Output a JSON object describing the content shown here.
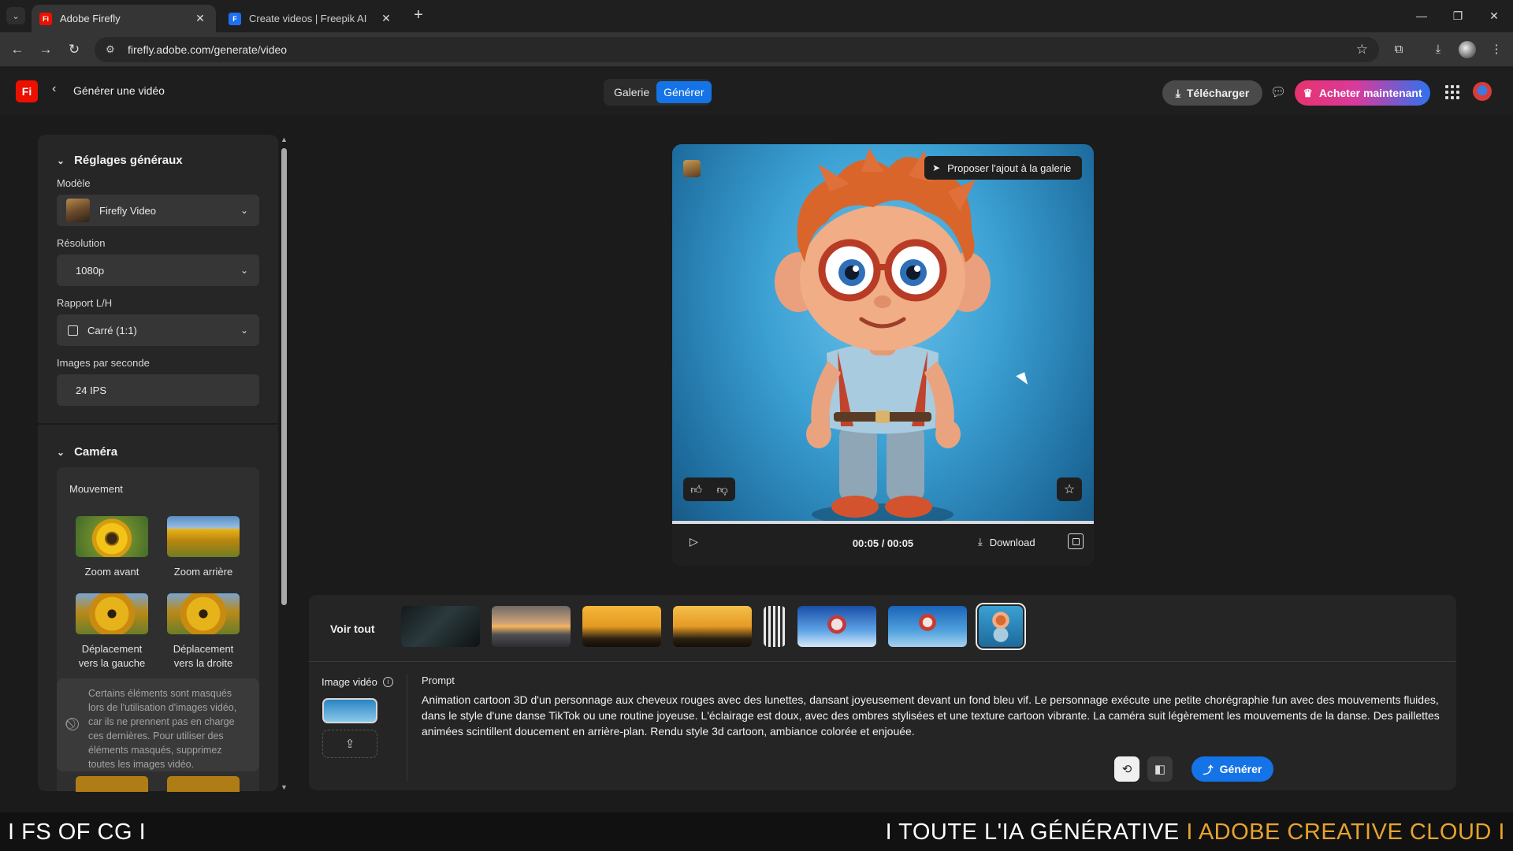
{
  "browser": {
    "tabs": [
      {
        "title": "Adobe Firefly",
        "favicon": "firefly-icon",
        "active": true
      },
      {
        "title": "Create videos | Freepik AI",
        "favicon": "freepik-icon",
        "active": false
      }
    ],
    "new_tab": "+",
    "url": "firefly.adobe.com/generate/video"
  },
  "app": {
    "logo": "Fi",
    "page_title": "Générer une vidéo",
    "segments": {
      "gallery": "Galerie",
      "generate": "Générer"
    },
    "download_label": "Télécharger",
    "buy_label": "Acheter maintenant",
    "accent": "#1473e6"
  },
  "settings": {
    "general_title": "Réglages généraux",
    "model_label": "Modèle",
    "model_value": "Firefly Video",
    "resolution_label": "Résolution",
    "resolution_value": "1080p",
    "ratio_label": "Rapport L/H",
    "ratio_value": "Carré (1:1)",
    "fps_label": "Images par seconde",
    "fps_value": "24 IPS",
    "camera_title": "Caméra",
    "motion_title": "Mouvement",
    "motions": [
      {
        "label": "Zoom avant"
      },
      {
        "label": "Zoom arrière"
      },
      {
        "label": "Déplacement vers la gauche"
      },
      {
        "label": "Déplacement vers la droite"
      }
    ],
    "notice": "Certains éléments sont masqués lors de l'utilisation d'images vidéo, car ils ne prennent pas en charge ces dernières. Pour utiliser des éléments masqués, supprimez toutes les images vidéo."
  },
  "player": {
    "propose_label": "Proposer l'ajout à la galerie",
    "time": "00:05 / 00:05",
    "progress": 1.0,
    "download_label": "Download"
  },
  "history": {
    "see_all": "Voir tout",
    "thumbs": [
      {
        "name": "thumb-dark-water"
      },
      {
        "name": "thumb-sunset-beach"
      },
      {
        "name": "thumb-silhouettes-1"
      },
      {
        "name": "thumb-silhouettes-2"
      },
      {
        "name": "thumb-striped"
      },
      {
        "name": "thumb-dancer-1"
      },
      {
        "name": "thumb-dancer-2"
      },
      {
        "name": "thumb-cartoon-boy"
      }
    ]
  },
  "prompt": {
    "image_video_label": "Image vidéo",
    "label": "Prompt",
    "text": "Animation cartoon 3D d'un personnage aux cheveux rouges avec des lunettes, dansant joyeusement devant un fond bleu vif. Le personnage exécute une petite chorégraphie fun avec des mouvements fluides, dans le style d'une danse TikTok ou une routine joyeuse. L'éclairage est doux, avec des ombres stylisées et une texture cartoon vibrante. La caméra suit légèrement les mouvements de la danse. Des paillettes animées scintillent doucement en arrière-plan. Rendu style 3d cartoon, ambiance colorée et enjouée.",
    "generate_label": "Générer"
  },
  "banner": {
    "left": "I FS OF CG I",
    "right_white": "I TOUTE L'IA GÉNÉRATIVE",
    "right_orange": "I ADOBE CREATIVE CLOUD I"
  }
}
